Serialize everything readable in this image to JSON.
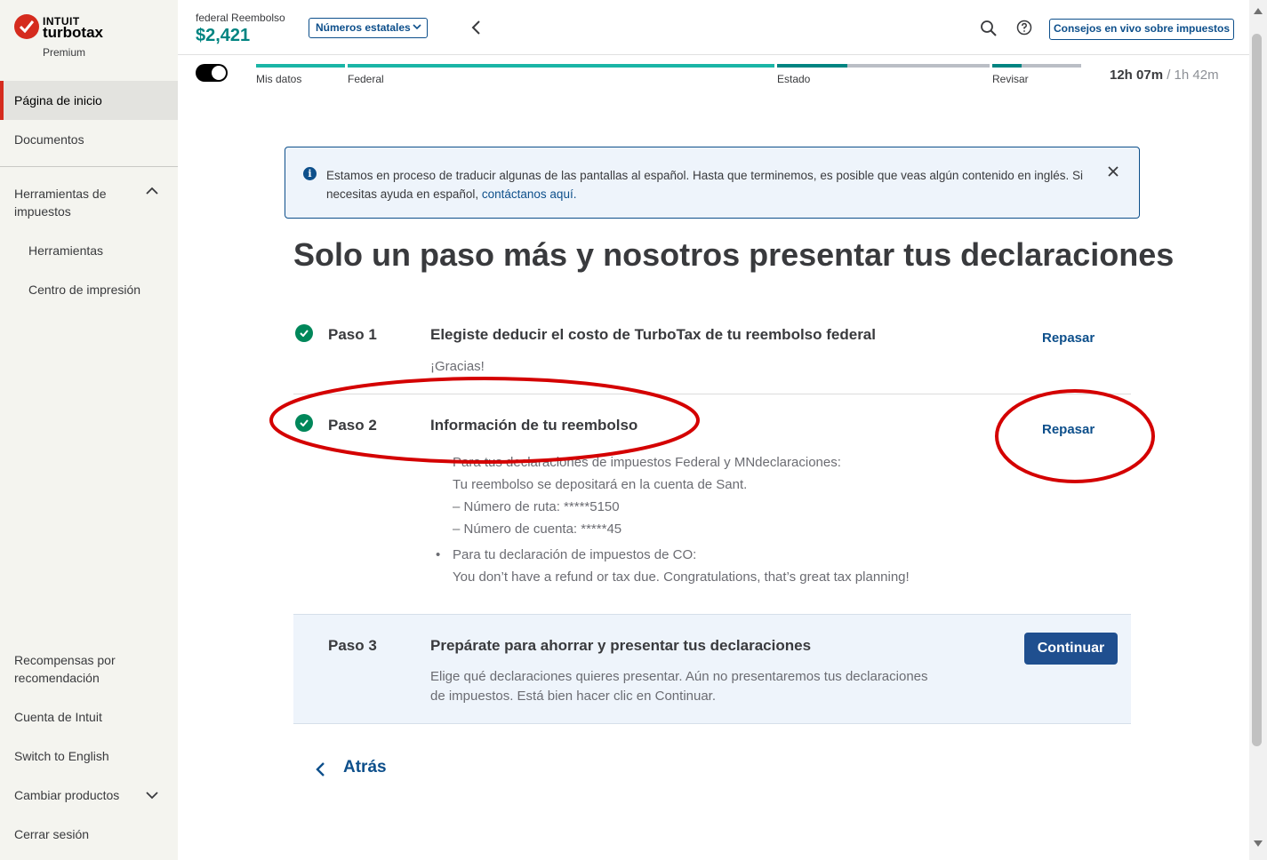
{
  "brand": {
    "company": "INTUIT",
    "product": "turbotax",
    "edition": "Premium"
  },
  "sidebar": {
    "items": [
      {
        "label": "Página de inicio"
      },
      {
        "label": "Documentos"
      },
      {
        "label": "Herramientas de impuestos"
      },
      {
        "label": "Herramientas"
      },
      {
        "label": "Centro de impresión"
      },
      {
        "label": "Recompensas por recomendación"
      },
      {
        "label": "Cuenta de Intuit"
      },
      {
        "label": "Switch to English"
      },
      {
        "label": "Cambiar productos"
      },
      {
        "label": "Cerrar sesión"
      }
    ]
  },
  "header": {
    "refund_label": "federal Reembolso",
    "refund_amount": "$2,421",
    "state_select": "Números estatales",
    "live_help_button": "Consejos en vivo sobre impuestos"
  },
  "progress": {
    "steps": [
      {
        "label": "Mis datos",
        "fill": 1.0
      },
      {
        "label": "Federal",
        "fill": 1.0
      },
      {
        "label": "Estado",
        "fill": 0.33
      },
      {
        "label": "Revisar",
        "fill": 0.33
      }
    ],
    "timer_elapsed": "12h 07m",
    "timer_total": "/ 1h 42m"
  },
  "banner": {
    "text": "Estamos en proceso de traducir algunas de las pantallas al español. Hasta que terminemos, es posible que veas algún contenido en inglés. Si necesitas ayuda en español, ",
    "link": "contáctanos aquí."
  },
  "main": {
    "title": "Solo un paso más y nosotros presentar tus declaraciones",
    "steps": [
      {
        "label": "Paso 1",
        "title": "Elegiste deducir el costo de TurboTax de tu reembolso federal",
        "body": [
          "¡Gracias!"
        ],
        "action": "Repasar"
      },
      {
        "label": "Paso 2",
        "title": "Información de tu reembolso",
        "body": [
          "Para tus declaraciones de impuestos Federal y MNdeclaraciones:",
          "Tu reembolso se depositará en la cuenta de Sant.",
          "– Número de ruta: *****5150",
          "– Número de cuenta: *****45",
          "Para tu declaración de impuestos de CO:",
          "You don’t have a refund or tax due. Congratulations, that’s great tax planning!"
        ],
        "action": "Repasar"
      },
      {
        "label": "Paso 3",
        "title": "Prepárate para ahorrar y presentar tus declaraciones",
        "body": [
          "Elige qué declaraciones quieres presentar. Aún no presentaremos tus declaraciones",
          "de impuestos. Está bien hacer clic en Continuar."
        ],
        "action": "Continuar"
      }
    ],
    "back_label": "Atrás"
  },
  "colors": {
    "accent": "#0d4f8b",
    "brand_red": "#d52b1e",
    "success": "#00875a",
    "refund": "#008481",
    "annotation": "#d40000"
  }
}
